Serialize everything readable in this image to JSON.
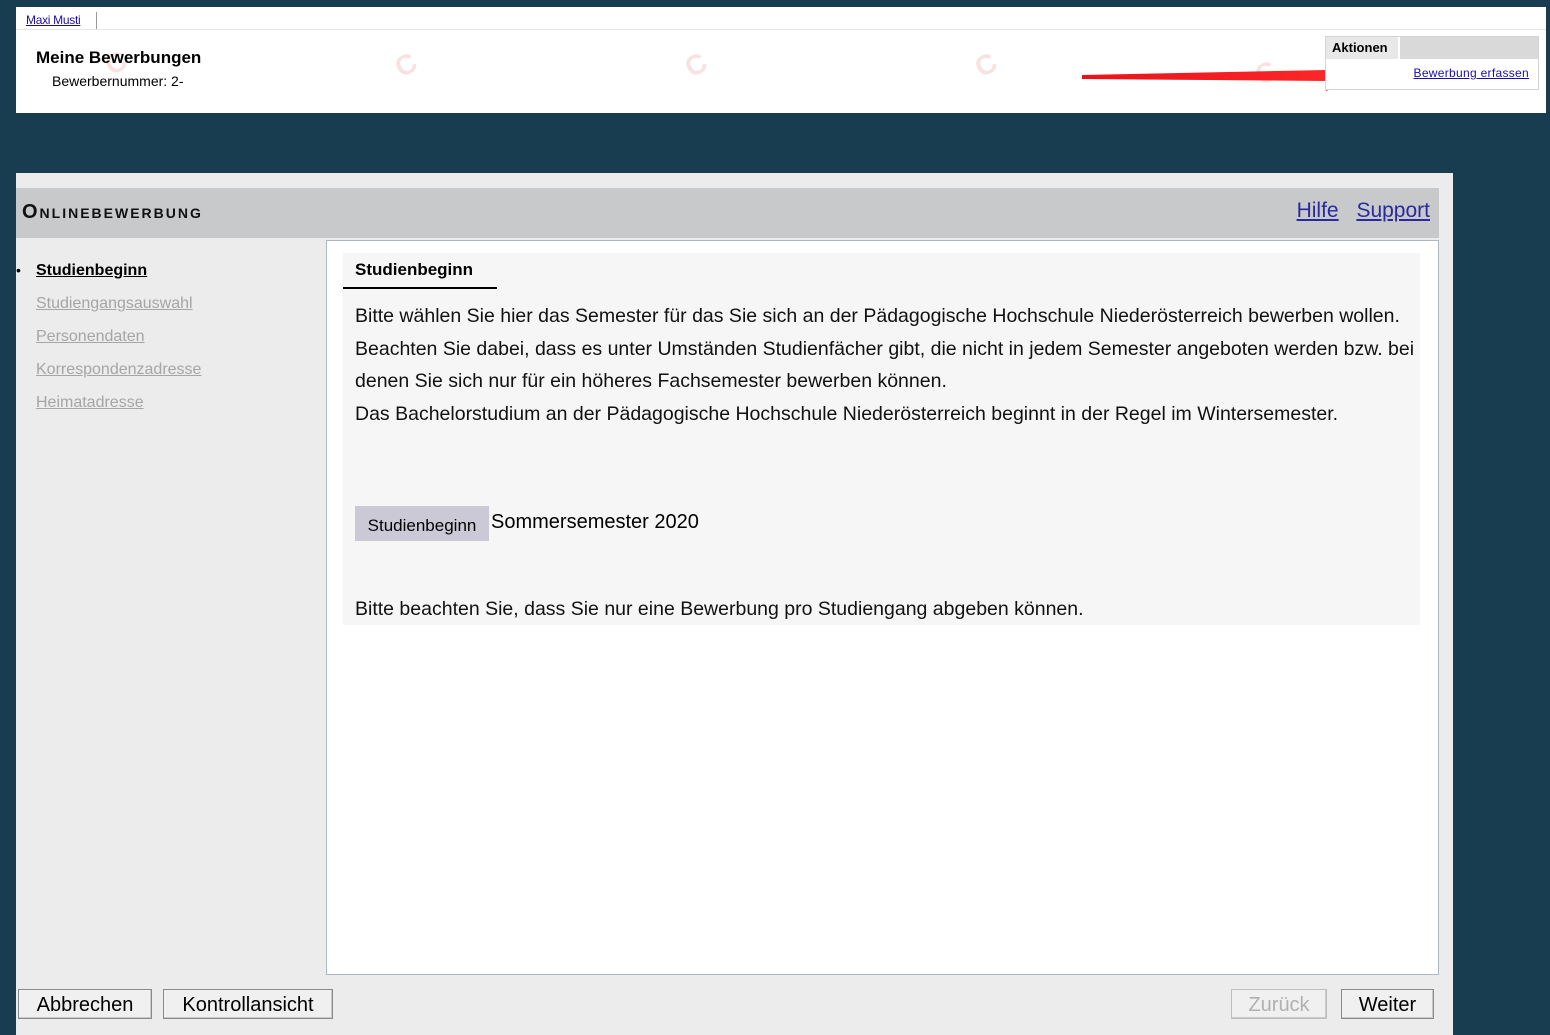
{
  "top": {
    "user_name": "Maxi Musti",
    "title": "Meine Bewerbungen",
    "applicant_number": "Bewerbernummer: 2-",
    "actions_label": "Aktionen",
    "create_link": "Bewerbung erfassen"
  },
  "header": {
    "title": "Onlinebewerbung",
    "help_link": "Hilfe",
    "support_link": "Support"
  },
  "sidebar": {
    "bullet": "•",
    "steps": [
      {
        "label": "Studienbeginn",
        "state": "active"
      },
      {
        "label": "Studiengangsauswahl",
        "state": "inactive"
      },
      {
        "label": "Personendaten",
        "state": "inactive"
      },
      {
        "label": "Korrespondenzadresse",
        "state": "inactive"
      },
      {
        "label": "Heimatadresse",
        "state": "inactive"
      }
    ]
  },
  "content": {
    "section_title": "Studienbeginn",
    "paragraph1": "Bitte wählen Sie hier das Semester für das Sie sich an der Pädagogische Hochschule Niederösterreich bewerben wollen.",
    "paragraph2": "Beachten Sie dabei, dass es unter Umständen Studienfächer gibt, die nicht in jedem Semester angeboten werden bzw. bei denen Sie sich nur für ein höheres Fachsemester bewerben können.",
    "paragraph3": "Das Bachelorstudium an der Pädagogische Hochschule Niederösterreich beginnt in der Regel im Wintersemester.",
    "field_label": "Studienbeginn",
    "field_value": "Sommersemester 2020",
    "notice": "Bitte beachten Sie, dass Sie nur eine Bewerbung pro Studiengang abgeben können."
  },
  "buttons": {
    "cancel": "Abbrechen",
    "control_view": "Kontrollansicht",
    "back": "Zurück",
    "next": "Weiter"
  },
  "colors": {
    "background": "#193d50",
    "arrow": "#e8141b",
    "link": "#1a0dab"
  }
}
